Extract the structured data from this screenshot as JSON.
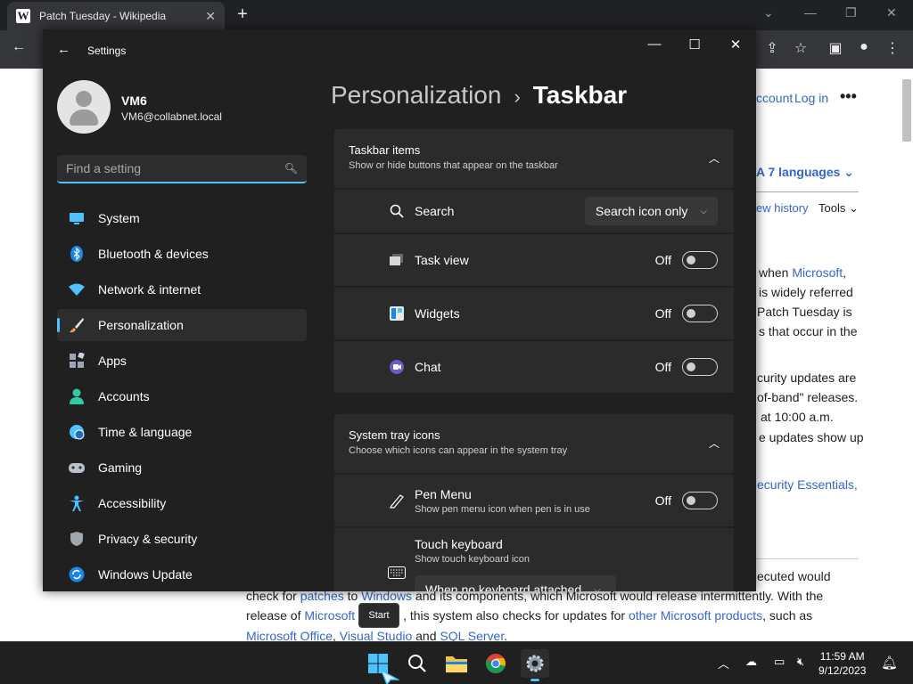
{
  "browser": {
    "tab_title": "Patch Tuesday - Wikipedia",
    "favicon_letter": "W",
    "new_tab_glyph": "+",
    "tab_close_glyph": "✕"
  },
  "wiki": {
    "top_links": [
      "ccount",
      "Log in"
    ],
    "languages": "7 languages",
    "view_history": "ew history",
    "tools": "Tools",
    "right_lines": [
      "when Microsoft,",
      "is widely referred",
      "Patch Tuesday is",
      "s that occur in the",
      "curity updates are",
      "of-band\" releases.",
      "at 10:00 a.m.",
      "e updates show up",
      "ecurity Essentials,"
    ],
    "bottom_lines": [
      "ecuted would",
      "check for patches to Windows and its components, which Microsoft would release intermittently. With the",
      "release of Microsoft , this system also checks for updates for other Microsoft products, such as",
      "Microsoft Office, Visual Studio and SQL Server."
    ],
    "tooltip": "Start"
  },
  "settings": {
    "window_title": "Settings",
    "user": {
      "name": "VM6",
      "email": "VM6@collabnet.local"
    },
    "search_placeholder": "Find a setting",
    "nav": [
      {
        "label": "System",
        "icon": "monitor-icon",
        "color": "#4cc2ff"
      },
      {
        "label": "Bluetooth & devices",
        "icon": "bluetooth-icon",
        "color": "#1a86e8"
      },
      {
        "label": "Network & internet",
        "icon": "wifi-icon",
        "color": "#4cc2ff"
      },
      {
        "label": "Personalization",
        "icon": "brush-icon",
        "color": "#f5a35c",
        "active": true
      },
      {
        "label": "Apps",
        "icon": "apps-icon",
        "color": "#9aa6b8"
      },
      {
        "label": "Accounts",
        "icon": "person-icon",
        "color": "#2fc9a4"
      },
      {
        "label": "Time & language",
        "icon": "globe-clock-icon",
        "color": "#4cc2ff"
      },
      {
        "label": "Gaming",
        "icon": "gamepad-icon",
        "color": "#b9c2cc"
      },
      {
        "label": "Accessibility",
        "icon": "accessibility-icon",
        "color": "#4cc2ff"
      },
      {
        "label": "Privacy & security",
        "icon": "shield-icon",
        "color": "#a0a6ad"
      },
      {
        "label": "Windows Update",
        "icon": "update-icon",
        "color": "#1a86e8"
      }
    ],
    "breadcrumb": {
      "parent": "Personalization",
      "separator": "›",
      "current": "Taskbar"
    },
    "taskbar_items": {
      "title": "Taskbar items",
      "subtitle": "Show or hide buttons that appear on the taskbar",
      "search": {
        "label": "Search",
        "value": "Search icon only"
      },
      "task_view": {
        "label": "Task view",
        "state": "Off"
      },
      "widgets": {
        "label": "Widgets",
        "state": "Off"
      },
      "chat": {
        "label": "Chat",
        "state": "Off"
      }
    },
    "system_tray": {
      "title": "System tray icons",
      "subtitle": "Choose which icons can appear in the system tray",
      "pen_menu": {
        "label": "Pen Menu",
        "sub": "Show pen menu icon when pen is in use",
        "state": "Off"
      },
      "touch_keyboard": {
        "label": "Touch keyboard",
        "sub": "Show touch keyboard icon",
        "value": "When no keyboard attached"
      }
    }
  },
  "taskbar": {
    "time": "11:59 AM",
    "date": "9/12/2023"
  }
}
